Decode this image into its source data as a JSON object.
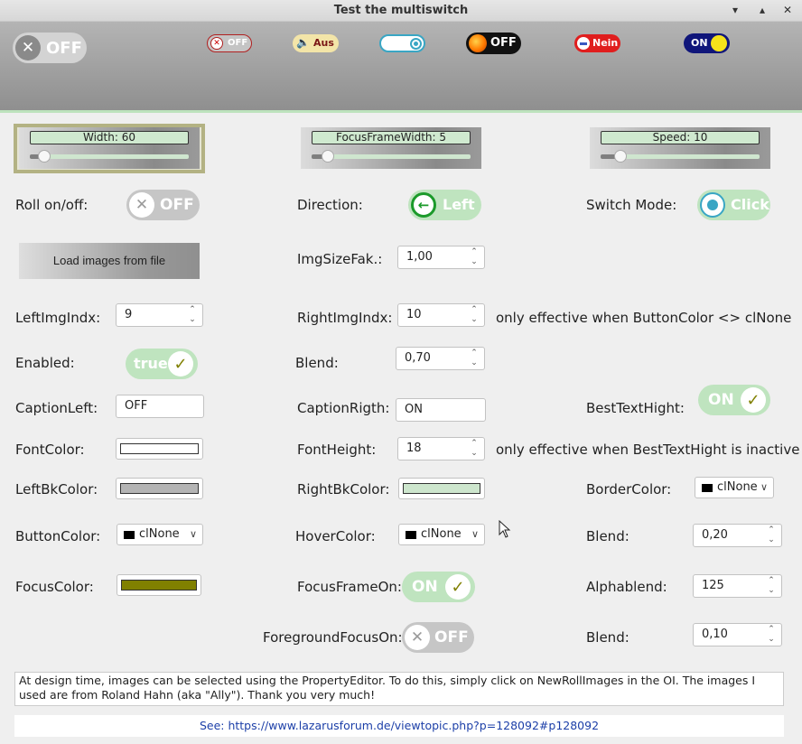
{
  "window": {
    "title": "Test the multiswitch",
    "minimize": "▾",
    "restore": "▴",
    "close": "✕"
  },
  "header_switches": [
    {
      "label": "OFF",
      "state": "off"
    },
    {
      "label": "OFF",
      "state": "off"
    },
    {
      "label": "Aus",
      "state": "off"
    },
    {
      "label": "",
      "state": "on"
    },
    {
      "label": "OFF",
      "state": "off"
    },
    {
      "label": "Nein",
      "state": "off"
    },
    {
      "label": "ON",
      "state": "on"
    }
  ],
  "sliders": [
    {
      "caption": "Width:  60",
      "value": 60
    },
    {
      "caption": "FocusFrameWidth: 5",
      "value": 5
    },
    {
      "caption": "Speed:  10",
      "value": 10
    }
  ],
  "fields": {
    "roll_label": "Roll on/off:",
    "roll_switch": "OFF",
    "direction_label": "Direction:",
    "direction_switch": "Left",
    "switch_mode_label": "Switch Mode:",
    "switch_mode_switch": "Click",
    "load_button": "Load images from file",
    "imgsize_label": "ImgSizeFak.:",
    "imgsize_value": "1,00",
    "leftimg_label": "LeftImgIndx:",
    "leftimg_value": "9",
    "rightimg_label": "RightImgIndx:",
    "rightimg_value": "10",
    "rightimg_note": "only effective when ButtonColor <> clNone",
    "enabled_label": "Enabled:",
    "enabled_switch": "true",
    "blend1_label": "Blend:",
    "blend1_value": "0,70",
    "captionleft_label": "CaptionLeft:",
    "captionleft_value": "OFF",
    "captionright_label": "CaptionRigth:",
    "captionright_value": "ON",
    "besttext_label": "BestTextHight:",
    "besttext_switch": "ON",
    "fontcolor_label": "FontColor:",
    "fontheight_label": "FontHeight:",
    "fontheight_value": "18",
    "fontheight_note": "only effective when BestTextHight is inactive",
    "leftbk_label": "LeftBkColor:",
    "rightbk_label": "RightBkColor:",
    "border_label": "BorderColor:",
    "border_value": "clNone",
    "buttoncolor_label": "ButtonColor:",
    "buttoncolor_value": "clNone",
    "hovercolor_label": "HoverColor:",
    "hovercolor_value": "clNone",
    "blend2_label": "Blend:",
    "blend2_value": "0,20",
    "focuscolor_label": "FocusColor:",
    "focusframe_label": "FocusFrameOn:",
    "focusframe_switch": "ON",
    "alphablend_label": "Alphablend:",
    "alphablend_value": "125",
    "foreground_label": "ForegroundFocusOn:",
    "foreground_switch": "OFF",
    "blend3_label": "Blend:",
    "blend3_value": "0,10"
  },
  "colors": {
    "font": "#ffffff",
    "left_bk": "#b4b4b4",
    "right_bk": "#cde6cd",
    "focus": "#808000",
    "pill_green": "#bfe4bf",
    "pill_grey": "#c4c4c4"
  },
  "note": "At design time, images can be selected using the PropertyEditor. To do this, simply click on NewRollImages in the OI. The images I used are from Roland Hahn (aka \"Ally\"). Thank you very much!",
  "link": "See: https://www.lazarusforum.de/viewtopic.php?p=128092#p128092"
}
